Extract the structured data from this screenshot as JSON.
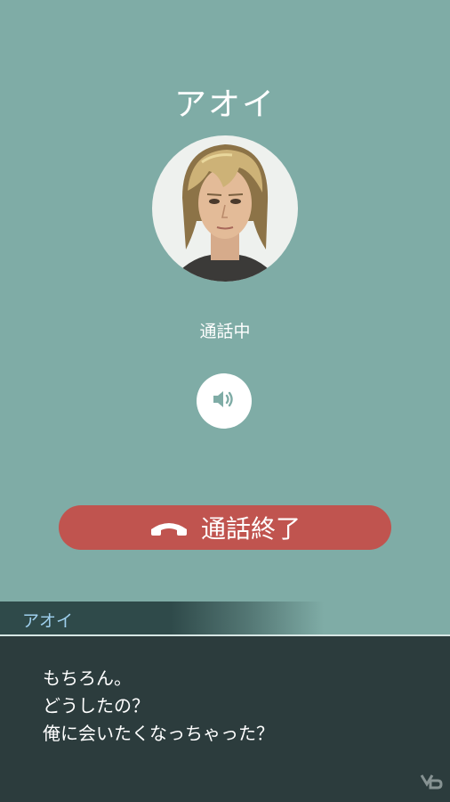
{
  "call": {
    "caller_name": "アオイ",
    "status": "通話中",
    "speaker_icon": "speaker-icon",
    "end_call_label": "通話終了",
    "end_call_icon": "phone-hangup-icon"
  },
  "dialogue": {
    "speaker": "アオイ",
    "lines": [
      "もちろん。",
      "どうしたの？",
      "俺に会いたくなっちゃった？"
    ]
  },
  "colors": {
    "background": "#7faca6",
    "end_call": "#c0544f",
    "dialogue_bg": "#2c3c3d",
    "speaker_name": "#9fd0ee"
  }
}
